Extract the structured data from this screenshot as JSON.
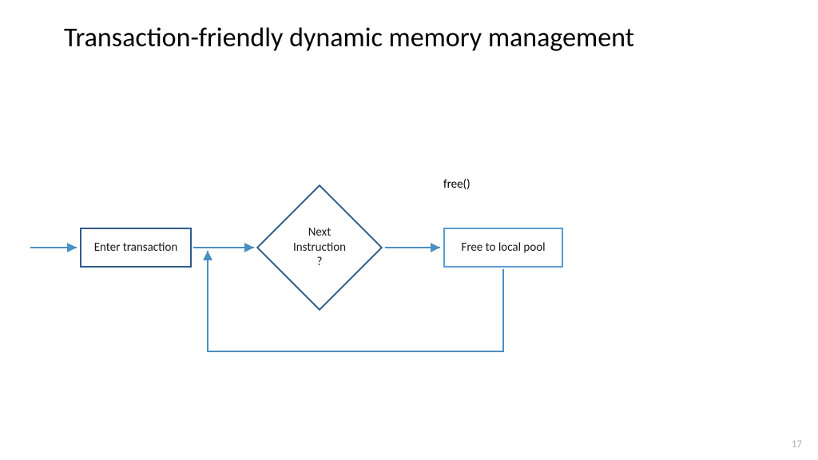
{
  "title": "Transaction-friendly dynamic memory management",
  "page_number": "17",
  "colors": {
    "dark_border": "#2f5d88",
    "arrow": "#4a8fc2",
    "light_border": "#5a9bd4"
  },
  "nodes": {
    "enter": {
      "label": "Enter transaction"
    },
    "decision": {
      "label": "Next\nInstruction\n?"
    },
    "decision_branch_label": "free()",
    "free_pool": {
      "label": "Free to local pool"
    }
  }
}
